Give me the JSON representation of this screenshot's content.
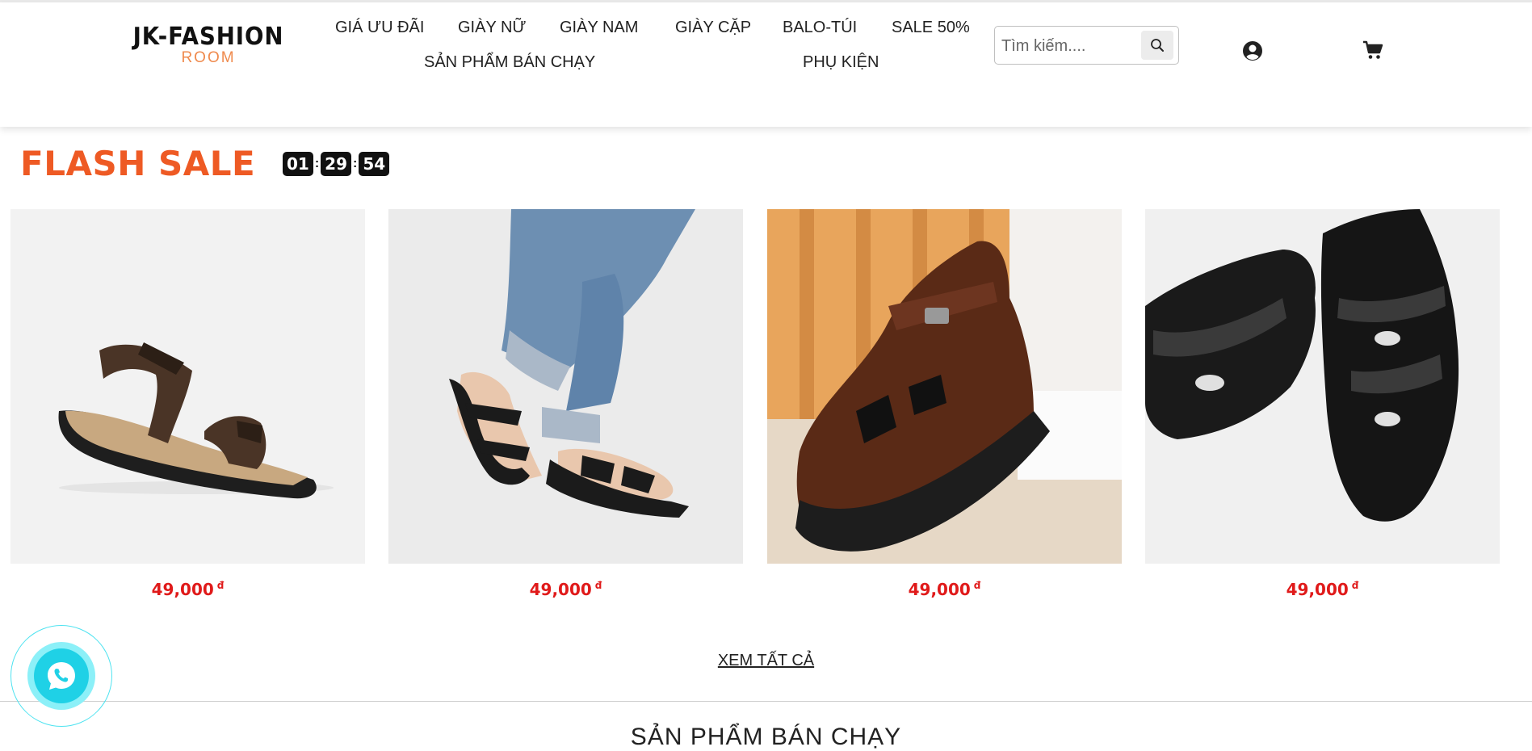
{
  "header": {
    "logo": {
      "main": "JK-FASHION",
      "sub": "ROOM",
      "sub_color": "#ef8a4d"
    },
    "nav": {
      "row1": [
        "GIÁ ƯU ĐÃI",
        "GIÀY NỮ",
        "GIÀY NAM",
        "GIÀY CẶP",
        "BALO-TÚI",
        "SALE 50%"
      ],
      "row2": [
        "SẢN PHẨM BÁN CHẠY",
        "PHỤ KIỆN"
      ]
    },
    "search": {
      "placeholder": "Tìm kiếm....",
      "icon": "search-icon"
    },
    "icons": {
      "account": "user-circle-icon",
      "cart": "cart-icon"
    }
  },
  "flash_sale": {
    "title": "FLASH SALE",
    "title_color": "#ee5a24",
    "countdown": {
      "hours": "01",
      "minutes": "29",
      "seconds": "54",
      "separator": ":"
    }
  },
  "products": [
    {
      "image": "brown sport sandal",
      "price": "49,000",
      "currency": "đ"
    },
    {
      "image": "black strap sandal worn with jeans",
      "price": "49,000",
      "currency": "đ"
    },
    {
      "image": "brown leather closed-toe sandal",
      "price": "49,000",
      "currency": "đ"
    },
    {
      "image": "black leather closed-toe sandal",
      "price": "49,000",
      "currency": "đ"
    }
  ],
  "price_color": "#e01a1a",
  "see_all_label": "XEM TẤT CẢ",
  "next_section_title": "SẢN PHẨM BÁN CHẠY",
  "chat_widget": {
    "icon": "phone-chat-icon",
    "color": "#1fd1e6"
  }
}
